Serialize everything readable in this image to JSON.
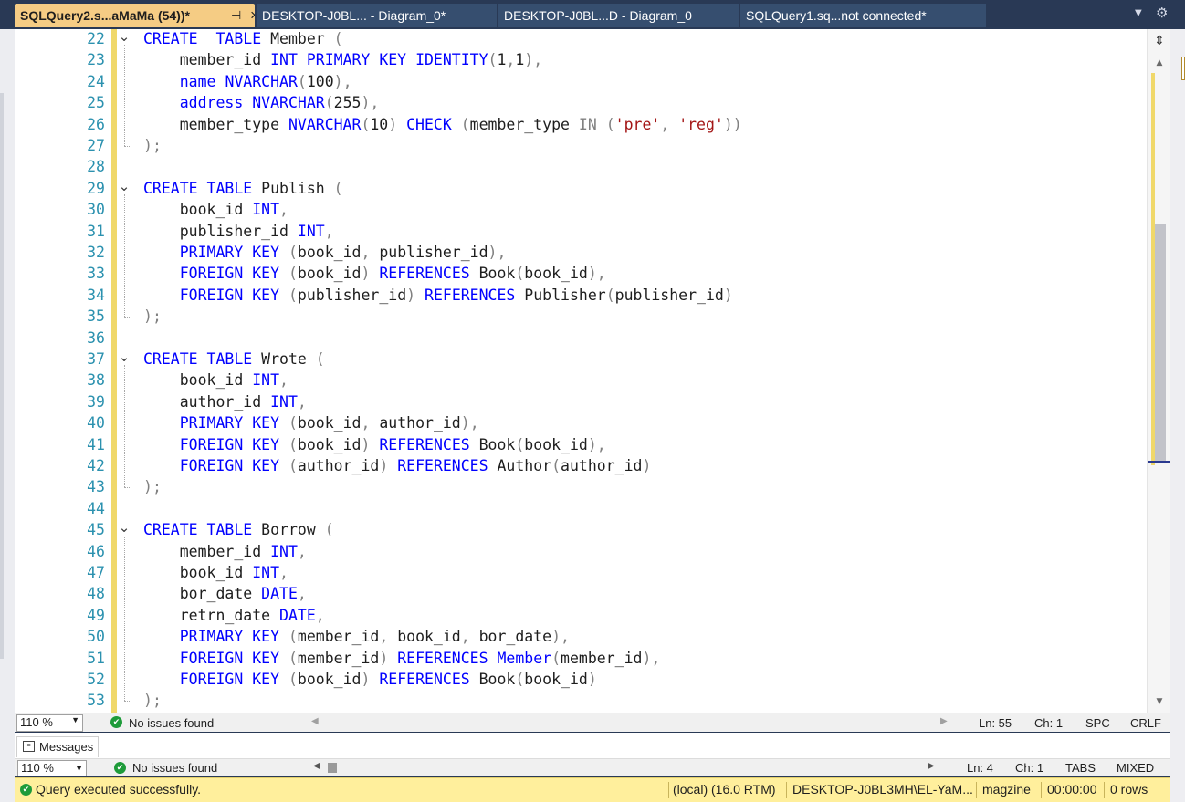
{
  "tabs": [
    {
      "label": "SQLQuery2.s...aMaMa (54))*",
      "active": true
    },
    {
      "label": "DESKTOP-J0BL... - Diagram_0*",
      "active": false
    },
    {
      "label": "DESKTOP-J0BL...D - Diagram_0",
      "active": false
    },
    {
      "label": "SQLQuery1.sq...not connected*",
      "active": false
    }
  ],
  "tab_icons": {
    "pin": "pin-icon",
    "close": "close-icon",
    "dropdown": "chevron-down-icon",
    "settings": "gear-icon"
  },
  "editor": {
    "lines": [
      {
        "n": "22",
        "fold": "start",
        "tokens": [
          [
            "kw",
            "CREATE"
          ],
          [
            "",
            "  "
          ],
          [
            "kw",
            "TABLE"
          ],
          [
            "",
            " Member "
          ],
          [
            "gr",
            "("
          ]
        ]
      },
      {
        "n": "23",
        "tokens": [
          [
            "",
            "    member_id "
          ],
          [
            "kw",
            "INT"
          ],
          [
            "",
            " "
          ],
          [
            "kw",
            "PRIMARY"
          ],
          [
            "",
            " "
          ],
          [
            "kw",
            "KEY"
          ],
          [
            "",
            " "
          ],
          [
            "kw",
            "IDENTITY"
          ],
          [
            "gr",
            "("
          ],
          [
            "",
            "1"
          ],
          [
            "gr",
            ","
          ],
          [
            "",
            "1"
          ],
          [
            "gr",
            ")"
          ],
          [
            "gr",
            ","
          ]
        ]
      },
      {
        "n": "24",
        "tokens": [
          [
            "",
            "    "
          ],
          [
            "kw",
            "name"
          ],
          [
            "",
            " "
          ],
          [
            "kw",
            "NVARCHAR"
          ],
          [
            "gr",
            "("
          ],
          [
            "",
            "100"
          ],
          [
            "gr",
            ")"
          ],
          [
            "gr",
            ","
          ]
        ]
      },
      {
        "n": "25",
        "tokens": [
          [
            "",
            "    "
          ],
          [
            "kw",
            "address"
          ],
          [
            "",
            " "
          ],
          [
            "kw",
            "NVARCHAR"
          ],
          [
            "gr",
            "("
          ],
          [
            "",
            "255"
          ],
          [
            "gr",
            ")"
          ],
          [
            "gr",
            ","
          ]
        ]
      },
      {
        "n": "26",
        "tokens": [
          [
            "",
            "    member_type "
          ],
          [
            "kw",
            "NVARCHAR"
          ],
          [
            "gr",
            "("
          ],
          [
            "",
            "10"
          ],
          [
            "gr",
            ")"
          ],
          [
            "",
            " "
          ],
          [
            "kw",
            "CHECK"
          ],
          [
            "",
            " "
          ],
          [
            "gr",
            "("
          ],
          [
            "",
            "member_type "
          ],
          [
            "gr",
            "IN"
          ],
          [
            "",
            " "
          ],
          [
            "gr",
            "("
          ],
          [
            "st",
            "'pre'"
          ],
          [
            "gr",
            ","
          ],
          [
            "",
            " "
          ],
          [
            "st",
            "'reg'"
          ],
          [
            "gr",
            "))"
          ]
        ]
      },
      {
        "n": "27",
        "fold": "end",
        "tokens": [
          [
            "gr",
            ")"
          ],
          [
            "gr",
            ";"
          ]
        ]
      },
      {
        "n": "28",
        "tokens": []
      },
      {
        "n": "29",
        "fold": "start",
        "tokens": [
          [
            "kw",
            "CREATE"
          ],
          [
            "",
            " "
          ],
          [
            "kw",
            "TABLE"
          ],
          [
            "",
            " Publish "
          ],
          [
            "gr",
            "("
          ]
        ]
      },
      {
        "n": "30",
        "tokens": [
          [
            "",
            "    book_id "
          ],
          [
            "kw",
            "INT"
          ],
          [
            "gr",
            ","
          ]
        ]
      },
      {
        "n": "31",
        "tokens": [
          [
            "",
            "    publisher_id "
          ],
          [
            "kw",
            "INT"
          ],
          [
            "gr",
            ","
          ]
        ]
      },
      {
        "n": "32",
        "tokens": [
          [
            "",
            "    "
          ],
          [
            "kw",
            "PRIMARY"
          ],
          [
            "",
            " "
          ],
          [
            "kw",
            "KEY"
          ],
          [
            "",
            " "
          ],
          [
            "gr",
            "("
          ],
          [
            "",
            "book_id"
          ],
          [
            "gr",
            ","
          ],
          [
            "",
            " publisher_id"
          ],
          [
            "gr",
            ")"
          ],
          [
            "gr",
            ","
          ]
        ]
      },
      {
        "n": "33",
        "tokens": [
          [
            "",
            "    "
          ],
          [
            "kw",
            "FOREIGN"
          ],
          [
            "",
            " "
          ],
          [
            "kw",
            "KEY"
          ],
          [
            "",
            " "
          ],
          [
            "gr",
            "("
          ],
          [
            "",
            "book_id"
          ],
          [
            "gr",
            ")"
          ],
          [
            "",
            " "
          ],
          [
            "kw",
            "REFERENCES"
          ],
          [
            "",
            " Book"
          ],
          [
            "gr",
            "("
          ],
          [
            "",
            "book_id"
          ],
          [
            "gr",
            ")"
          ],
          [
            "gr",
            ","
          ]
        ]
      },
      {
        "n": "34",
        "tokens": [
          [
            "",
            "    "
          ],
          [
            "kw",
            "FOREIGN"
          ],
          [
            "",
            " "
          ],
          [
            "kw",
            "KEY"
          ],
          [
            "",
            " "
          ],
          [
            "gr",
            "("
          ],
          [
            "",
            "publisher_id"
          ],
          [
            "gr",
            ")"
          ],
          [
            "",
            " "
          ],
          [
            "kw",
            "REFERENCES"
          ],
          [
            "",
            " Publisher"
          ],
          [
            "gr",
            "("
          ],
          [
            "",
            "publisher_id"
          ],
          [
            "gr",
            ")"
          ]
        ]
      },
      {
        "n": "35",
        "fold": "end",
        "tokens": [
          [
            "gr",
            ")"
          ],
          [
            "gr",
            ";"
          ]
        ]
      },
      {
        "n": "36",
        "tokens": []
      },
      {
        "n": "37",
        "fold": "start",
        "tokens": [
          [
            "kw",
            "CREATE"
          ],
          [
            "",
            " "
          ],
          [
            "kw",
            "TABLE"
          ],
          [
            "",
            " Wrote "
          ],
          [
            "gr",
            "("
          ]
        ]
      },
      {
        "n": "38",
        "tokens": [
          [
            "",
            "    book_id "
          ],
          [
            "kw",
            "INT"
          ],
          [
            "gr",
            ","
          ]
        ]
      },
      {
        "n": "39",
        "tokens": [
          [
            "",
            "    author_id "
          ],
          [
            "kw",
            "INT"
          ],
          [
            "gr",
            ","
          ]
        ]
      },
      {
        "n": "40",
        "tokens": [
          [
            "",
            "    "
          ],
          [
            "kw",
            "PRIMARY"
          ],
          [
            "",
            " "
          ],
          [
            "kw",
            "KEY"
          ],
          [
            "",
            " "
          ],
          [
            "gr",
            "("
          ],
          [
            "",
            "book_id"
          ],
          [
            "gr",
            ","
          ],
          [
            "",
            " author_id"
          ],
          [
            "gr",
            ")"
          ],
          [
            "gr",
            ","
          ]
        ]
      },
      {
        "n": "41",
        "tokens": [
          [
            "",
            "    "
          ],
          [
            "kw",
            "FOREIGN"
          ],
          [
            "",
            " "
          ],
          [
            "kw",
            "KEY"
          ],
          [
            "",
            " "
          ],
          [
            "gr",
            "("
          ],
          [
            "",
            "book_id"
          ],
          [
            "gr",
            ")"
          ],
          [
            "",
            " "
          ],
          [
            "kw",
            "REFERENCES"
          ],
          [
            "",
            " Book"
          ],
          [
            "gr",
            "("
          ],
          [
            "",
            "book_id"
          ],
          [
            "gr",
            ")"
          ],
          [
            "gr",
            ","
          ]
        ]
      },
      {
        "n": "42",
        "tokens": [
          [
            "",
            "    "
          ],
          [
            "kw",
            "FOREIGN"
          ],
          [
            "",
            " "
          ],
          [
            "kw",
            "KEY"
          ],
          [
            "",
            " "
          ],
          [
            "gr",
            "("
          ],
          [
            "",
            "author_id"
          ],
          [
            "gr",
            ")"
          ],
          [
            "",
            " "
          ],
          [
            "kw",
            "REFERENCES"
          ],
          [
            "",
            " Author"
          ],
          [
            "gr",
            "("
          ],
          [
            "",
            "author_id"
          ],
          [
            "gr",
            ")"
          ]
        ]
      },
      {
        "n": "43",
        "fold": "end",
        "tokens": [
          [
            "gr",
            ")"
          ],
          [
            "gr",
            ";"
          ]
        ]
      },
      {
        "n": "44",
        "tokens": []
      },
      {
        "n": "45",
        "fold": "start",
        "tokens": [
          [
            "kw",
            "CREATE"
          ],
          [
            "",
            " "
          ],
          [
            "kw",
            "TABLE"
          ],
          [
            "",
            " Borrow "
          ],
          [
            "gr",
            "("
          ]
        ]
      },
      {
        "n": "46",
        "tokens": [
          [
            "",
            "    member_id "
          ],
          [
            "kw",
            "INT"
          ],
          [
            "gr",
            ","
          ]
        ]
      },
      {
        "n": "47",
        "tokens": [
          [
            "",
            "    book_id "
          ],
          [
            "kw",
            "INT"
          ],
          [
            "gr",
            ","
          ]
        ]
      },
      {
        "n": "48",
        "tokens": [
          [
            "",
            "    bor_date "
          ],
          [
            "kw",
            "DATE"
          ],
          [
            "gr",
            ","
          ]
        ]
      },
      {
        "n": "49",
        "tokens": [
          [
            "",
            "    retrn_date "
          ],
          [
            "kw",
            "DATE"
          ],
          [
            "gr",
            ","
          ]
        ]
      },
      {
        "n": "50",
        "tokens": [
          [
            "",
            "    "
          ],
          [
            "kw",
            "PRIMARY"
          ],
          [
            "",
            " "
          ],
          [
            "kw",
            "KEY"
          ],
          [
            "",
            " "
          ],
          [
            "gr",
            "("
          ],
          [
            "",
            "member_id"
          ],
          [
            "gr",
            ","
          ],
          [
            "",
            " book_id"
          ],
          [
            "gr",
            ","
          ],
          [
            "",
            " bor_date"
          ],
          [
            "gr",
            ")"
          ],
          [
            "gr",
            ","
          ]
        ]
      },
      {
        "n": "51",
        "tokens": [
          [
            "",
            "    "
          ],
          [
            "kw",
            "FOREIGN"
          ],
          [
            "",
            " "
          ],
          [
            "kw",
            "KEY"
          ],
          [
            "",
            " "
          ],
          [
            "gr",
            "("
          ],
          [
            "",
            "member_id"
          ],
          [
            "gr",
            ")"
          ],
          [
            "",
            " "
          ],
          [
            "kw",
            "REFERENCES"
          ],
          [
            "",
            " "
          ],
          [
            "kw",
            "Member"
          ],
          [
            "gr",
            "("
          ],
          [
            "",
            "member_id"
          ],
          [
            "gr",
            ")"
          ],
          [
            "gr",
            ","
          ]
        ]
      },
      {
        "n": "52",
        "tokens": [
          [
            "",
            "    "
          ],
          [
            "kw",
            "FOREIGN"
          ],
          [
            "",
            " "
          ],
          [
            "kw",
            "KEY"
          ],
          [
            "",
            " "
          ],
          [
            "gr",
            "("
          ],
          [
            "",
            "book_id"
          ],
          [
            "gr",
            ")"
          ],
          [
            "",
            " "
          ],
          [
            "kw",
            "REFERENCES"
          ],
          [
            "",
            " Book"
          ],
          [
            "gr",
            "("
          ],
          [
            "",
            "book_id"
          ],
          [
            "gr",
            ")"
          ]
        ]
      },
      {
        "n": "53",
        "fold": "end",
        "tokens": [
          [
            "gr",
            ")"
          ],
          [
            "gr",
            ";"
          ]
        ]
      }
    ]
  },
  "editor_status": {
    "zoom": "110 %",
    "issues": "No issues found",
    "ln": "Ln: 55",
    "ch": "Ch: 1",
    "indent": "SPC",
    "eol": "CRLF"
  },
  "results": {
    "tab_label": "Messages",
    "zoom": "110 %",
    "issues": "No issues found",
    "ln": "Ln: 4",
    "ch": "Ch: 1",
    "indent": "TABS",
    "eol": "MIXED"
  },
  "query_status": {
    "message": "Query executed successfully.",
    "server": "(local) (16.0 RTM)",
    "user": "DESKTOP-J0BL3MH\\EL-YaM...",
    "database": "magzine",
    "elapsed": "00:00:00",
    "rows": "0 rows"
  },
  "colors": {
    "keyword": "#0000ff",
    "punctuation": "#808080",
    "string": "#a31515",
    "line_number": "#2b91af",
    "active_tab": "#f5cc84",
    "status_bar": "#ffef9c"
  }
}
